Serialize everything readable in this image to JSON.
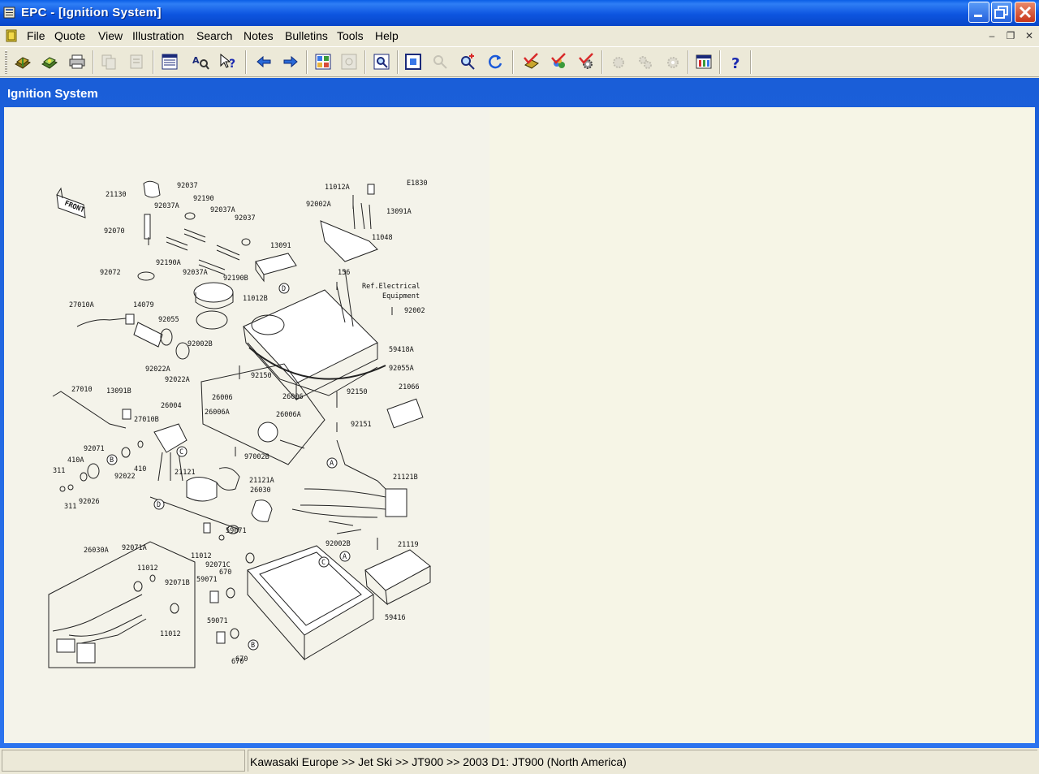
{
  "window": {
    "title": "EPC - [Ignition System]"
  },
  "menu": {
    "items": [
      "File",
      "Quote",
      "View",
      "Illustration",
      "Search",
      "Notes",
      "Bulletins",
      "Tools",
      "Help"
    ]
  },
  "toolbar": {
    "buttons": [
      {
        "name": "open-book-icon"
      },
      {
        "name": "catalog-icon"
      },
      {
        "name": "print-icon"
      },
      {
        "name": "copy-page-icon",
        "disabled": true
      },
      {
        "name": "paste-page-icon",
        "disabled": true
      },
      {
        "name": "parts-list-icon"
      },
      {
        "name": "search-text-icon"
      },
      {
        "name": "context-help-icon"
      },
      {
        "name": "back-arrow-icon"
      },
      {
        "name": "forward-arrow-icon"
      },
      {
        "name": "thumbnails-icon"
      },
      {
        "name": "image-disabled-icon",
        "disabled": true
      },
      {
        "name": "zoom-page-icon"
      },
      {
        "name": "fit-icon"
      },
      {
        "name": "zoom-out-icon",
        "disabled": true
      },
      {
        "name": "zoom-in-icon"
      },
      {
        "name": "refresh-icon"
      },
      {
        "name": "check-quote-icon"
      },
      {
        "name": "color-check-icon"
      },
      {
        "name": "check-gear-icon"
      },
      {
        "name": "gear-disabled-1-icon",
        "disabled": true
      },
      {
        "name": "gear-disabled-2-icon",
        "disabled": true
      },
      {
        "name": "gear-disabled-3-icon",
        "disabled": true
      },
      {
        "name": "settings-icon"
      },
      {
        "name": "help-icon"
      }
    ]
  },
  "document": {
    "title": "Ignition System"
  },
  "drawing": {
    "code": "E1830",
    "front_label": "FRONT",
    "ref_note": [
      "Ref.Electrical",
      "Equipment"
    ],
    "part_labels": [
      "21130",
      "92037",
      "92190",
      "92037A",
      "92037A",
      "92037",
      "13091",
      "92070",
      "92190A",
      "92037A",
      "92190B",
      "92072",
      "11012B",
      "92055",
      "27010A",
      "14079",
      "92002B",
      "92022A",
      "92022A",
      "11012A",
      "92002A",
      "13091A",
      "11048",
      "156",
      "92002",
      "59418A",
      "92055A",
      "92150",
      "92150",
      "21066",
      "92151",
      "27010",
      "13091B",
      "27010B",
      "26004",
      "26006",
      "26006",
      "26006A",
      "26006A",
      "97002B",
      "92071",
      "410A",
      "410",
      "92022",
      "311",
      "311",
      "92026",
      "21121",
      "21121B",
      "21121A",
      "26030",
      "11012",
      "92071C",
      "59071",
      "670",
      "26030A",
      "92071A",
      "11012",
      "92071B",
      "11012",
      "59071",
      "670",
      "59071",
      "670",
      "92002B",
      "21119",
      "59416"
    ],
    "circle_refs": [
      "D",
      "C",
      "B",
      "D",
      "A",
      "A",
      "C",
      "B"
    ]
  },
  "status": {
    "breadcrumb": "Kawasaki Europe >> Jet Ski >> JT900 >> 2003 D1: JT900 (North America)"
  }
}
